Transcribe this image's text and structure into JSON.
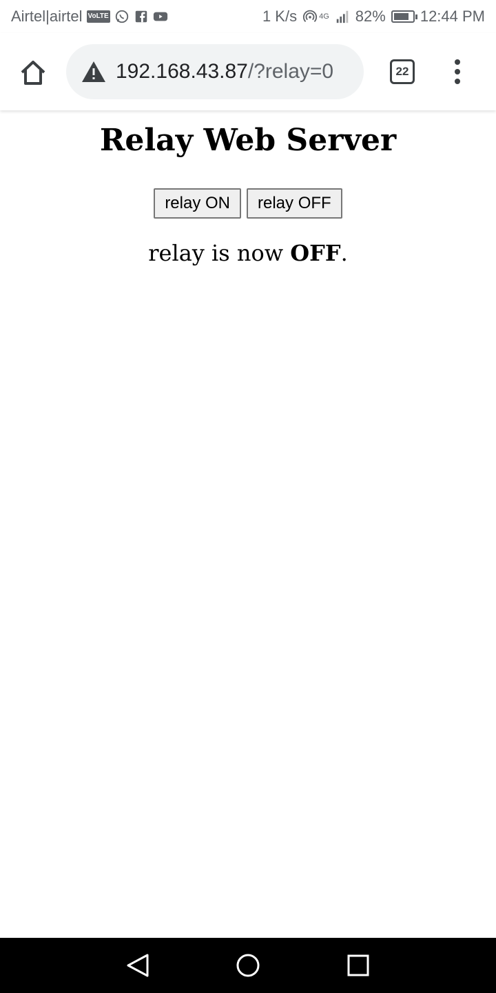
{
  "status_bar": {
    "carrier": "Airtel|airtel",
    "volte": "VoLTE",
    "speed": "1 K/s",
    "network": "4G",
    "battery": "82%",
    "battery_level": 0.82,
    "time": "12:44 PM",
    "icons": [
      "whatsapp-icon",
      "facebook-icon",
      "youtube-icon",
      "hotspot-icon",
      "signal-icon",
      "battery-icon"
    ]
  },
  "browser": {
    "url_host": "192.168.43.87",
    "url_path": "/?relay=0",
    "tab_count": "22",
    "icons": [
      "home-icon",
      "not-secure-warning-icon",
      "overflow-menu-icon"
    ]
  },
  "page": {
    "title": "Relay Web Server",
    "buttons": {
      "on_label": "relay ON",
      "off_label": "relay OFF"
    },
    "status_prefix": "relay is now ",
    "status_value": "OFF",
    "status_suffix": "."
  },
  "nav": {
    "icons": [
      "back-icon",
      "home-circle-icon",
      "recents-icon"
    ]
  },
  "colors": {
    "omnibox_bg": "#f1f3f4",
    "status_text": "#5f6368",
    "nav_bg": "#000000"
  }
}
